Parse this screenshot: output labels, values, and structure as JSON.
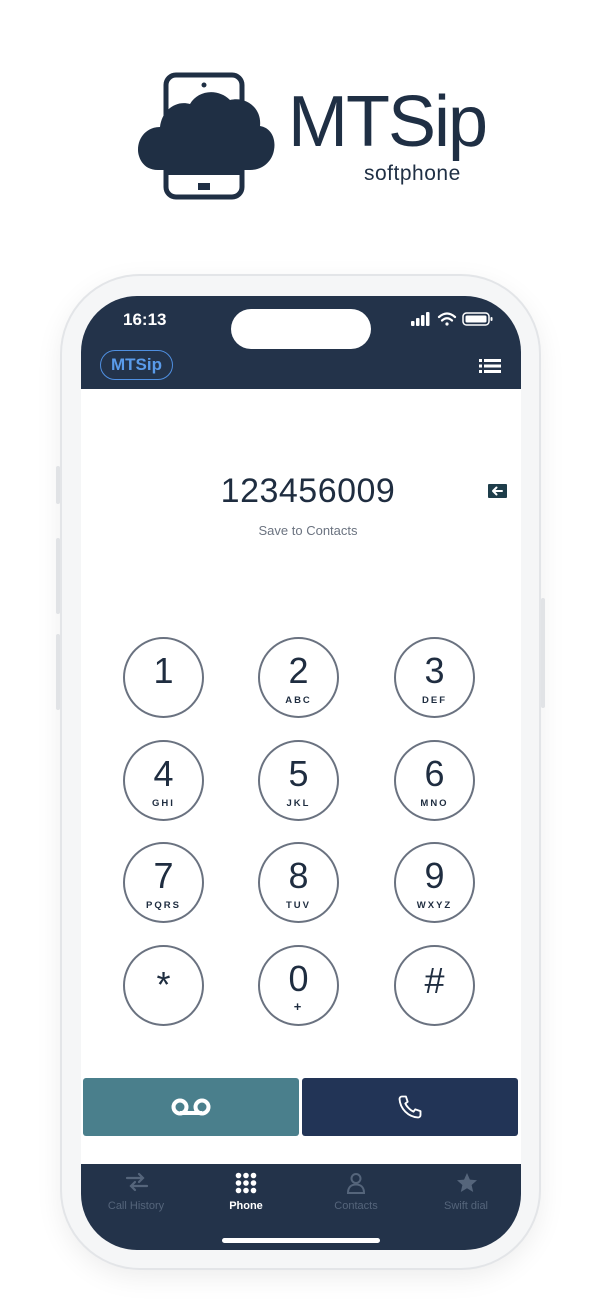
{
  "brand": {
    "name": "MTSip",
    "subtitle": "softphone",
    "icon": "cloud-phone-logo"
  },
  "status_bar": {
    "time": "16:13",
    "icons": [
      "signal-icon",
      "wifi-icon",
      "battery-icon"
    ]
  },
  "header": {
    "app_badge": "MTSip",
    "menu_icon": "list-menu-icon"
  },
  "dialer": {
    "number": "123456009",
    "save_label": "Save to Contacts",
    "backspace_icon": "backspace-icon"
  },
  "keypad": [
    {
      "digit": "1",
      "letters": ""
    },
    {
      "digit": "2",
      "letters": "ABC"
    },
    {
      "digit": "3",
      "letters": "DEF"
    },
    {
      "digit": "4",
      "letters": "GHI"
    },
    {
      "digit": "5",
      "letters": "JKL"
    },
    {
      "digit": "6",
      "letters": "MNO"
    },
    {
      "digit": "7",
      "letters": "PQRS"
    },
    {
      "digit": "8",
      "letters": "TUV"
    },
    {
      "digit": "9",
      "letters": "WXYZ"
    },
    {
      "digit": "*",
      "letters": ""
    },
    {
      "digit": "0",
      "letters": "+"
    },
    {
      "digit": "#",
      "letters": ""
    }
  ],
  "actions": {
    "voicemail_icon": "voicemail-icon",
    "call_icon": "phone-icon"
  },
  "tabs": [
    {
      "label": "Call History",
      "icon": "arrows-icon",
      "active": false
    },
    {
      "label": "Phone",
      "icon": "keypad-icon",
      "active": true
    },
    {
      "label": "Contacts",
      "icon": "person-icon",
      "active": false
    },
    {
      "label": "Swift dial",
      "icon": "star-icon",
      "active": false
    }
  ],
  "colors": {
    "header_bg": "#23334a",
    "accent_blue": "#5a9bea",
    "voicemail_btn": "#4a7f8c",
    "call_btn": "#223456",
    "tab_inactive": "#55657b"
  }
}
